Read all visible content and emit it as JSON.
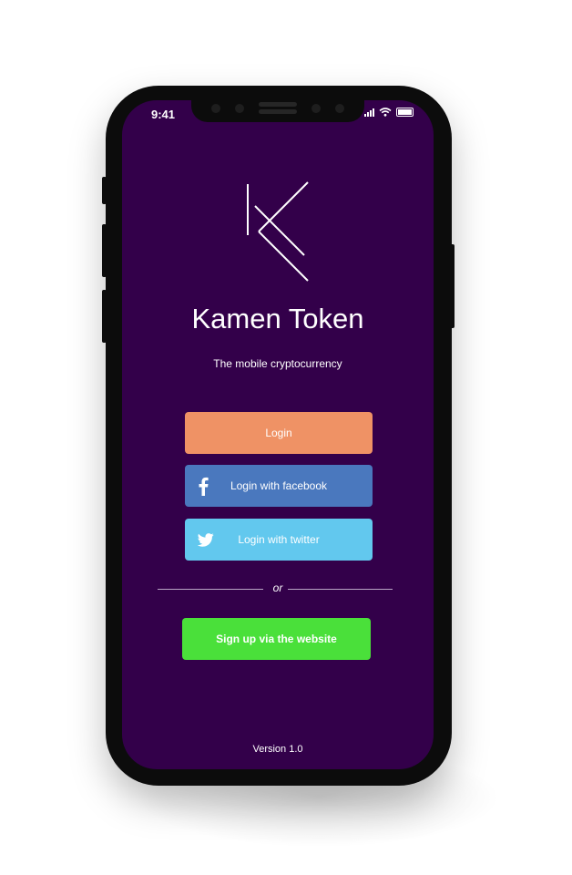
{
  "status_bar": {
    "time": "9:41"
  },
  "app": {
    "title": "Kamen Token",
    "subtitle": "The mobile cryptocurrency",
    "version": "Version 1.0"
  },
  "buttons": {
    "login": "Login",
    "facebook": "Login with facebook",
    "twitter": "Login with twitter",
    "signup": "Sign up via the website"
  },
  "divider": {
    "text": "or"
  },
  "icons": {
    "logo": "k-logo",
    "facebook": "facebook-icon",
    "twitter": "twitter-icon",
    "signal": "signal-icon",
    "wifi": "wifi-icon",
    "battery": "battery-icon"
  },
  "colors": {
    "background": "#33004a",
    "login": "#ef9265",
    "facebook": "#4a78be",
    "twitter": "#62c8ee",
    "signup": "#4ae03a"
  }
}
